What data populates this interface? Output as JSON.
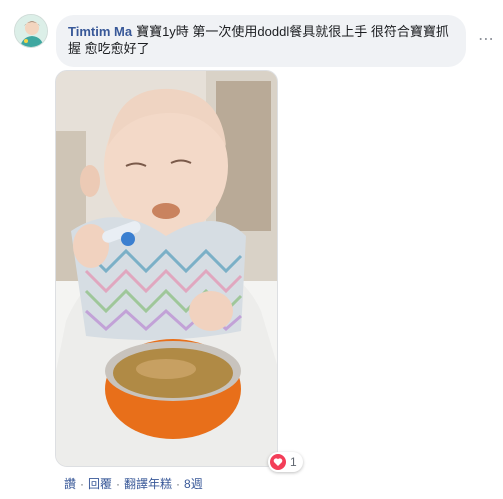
{
  "comment": {
    "author": "Timtim Ma",
    "text": "寶寶1y時 第一次使用doddl餐具就很上手 很符合寶寶抓握 愈吃愈好了"
  },
  "more_options_glyph": "⋯",
  "reactions": {
    "type": "love-icon",
    "count": "1"
  },
  "actions": {
    "like": "讚",
    "reply": "回覆",
    "translate": "翻譯年糕",
    "separator": "·",
    "time": "8週"
  },
  "colors": {
    "author": "#385898",
    "bubble": "#f0f2f5",
    "heart": "#f33e58",
    "meta": "#606770"
  }
}
